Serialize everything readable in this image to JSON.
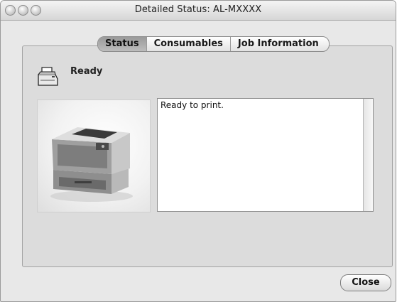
{
  "window": {
    "title": "Detailed Status: AL-MXXXX",
    "traffic_lights": [
      "close-light",
      "minimize-light",
      "zoom-light"
    ]
  },
  "tabs": [
    {
      "label": "Status",
      "active": true
    },
    {
      "label": "Consumables",
      "active": false
    },
    {
      "label": "Job Information",
      "active": false
    }
  ],
  "status": {
    "icon": "printer-icon",
    "label": "Ready",
    "message": "Ready to print."
  },
  "printer_image": "laser-printer-image",
  "buttons": {
    "close_label": "Close"
  }
}
